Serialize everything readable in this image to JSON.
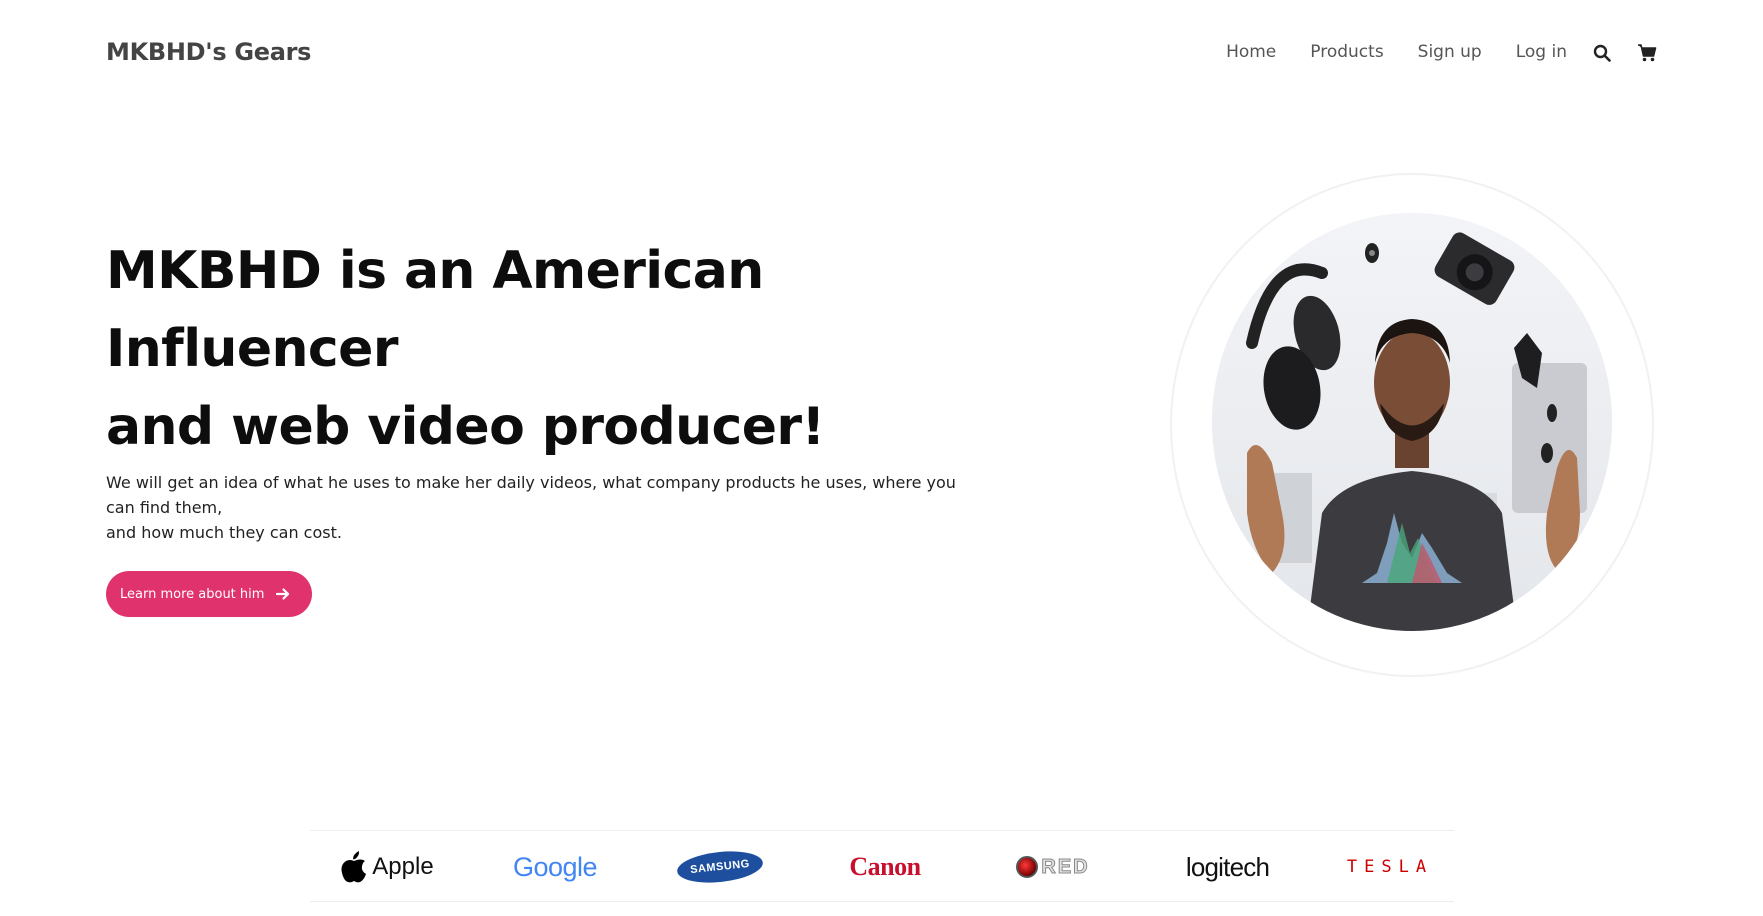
{
  "nav": {
    "brand": "MKBHD's Gears",
    "links": [
      "Home",
      "Products",
      "Sign up",
      "Log in"
    ],
    "icons": [
      "search-icon",
      "cart-icon"
    ]
  },
  "hero": {
    "title_lines": [
      "MKBHD is an American",
      "Influencer",
      "and web video producer!"
    ],
    "description_lines": [
      "We will get an idea of what he uses to make her daily videos, what company products he uses, where you can find them,",
      "and how much they can cost."
    ],
    "cta_label": "Learn more about him",
    "cta_icon": "arrow-right-icon"
  },
  "brands": {
    "logos": [
      "Apple",
      "Google",
      "SAMSUNG",
      "Canon",
      "RED",
      "logitech",
      "TESLA"
    ]
  },
  "colors": {
    "accent": "#e0336e",
    "samsung_blue": "#1d4f9e",
    "canon_red": "#c8102e",
    "tesla_red": "#cc0000"
  }
}
